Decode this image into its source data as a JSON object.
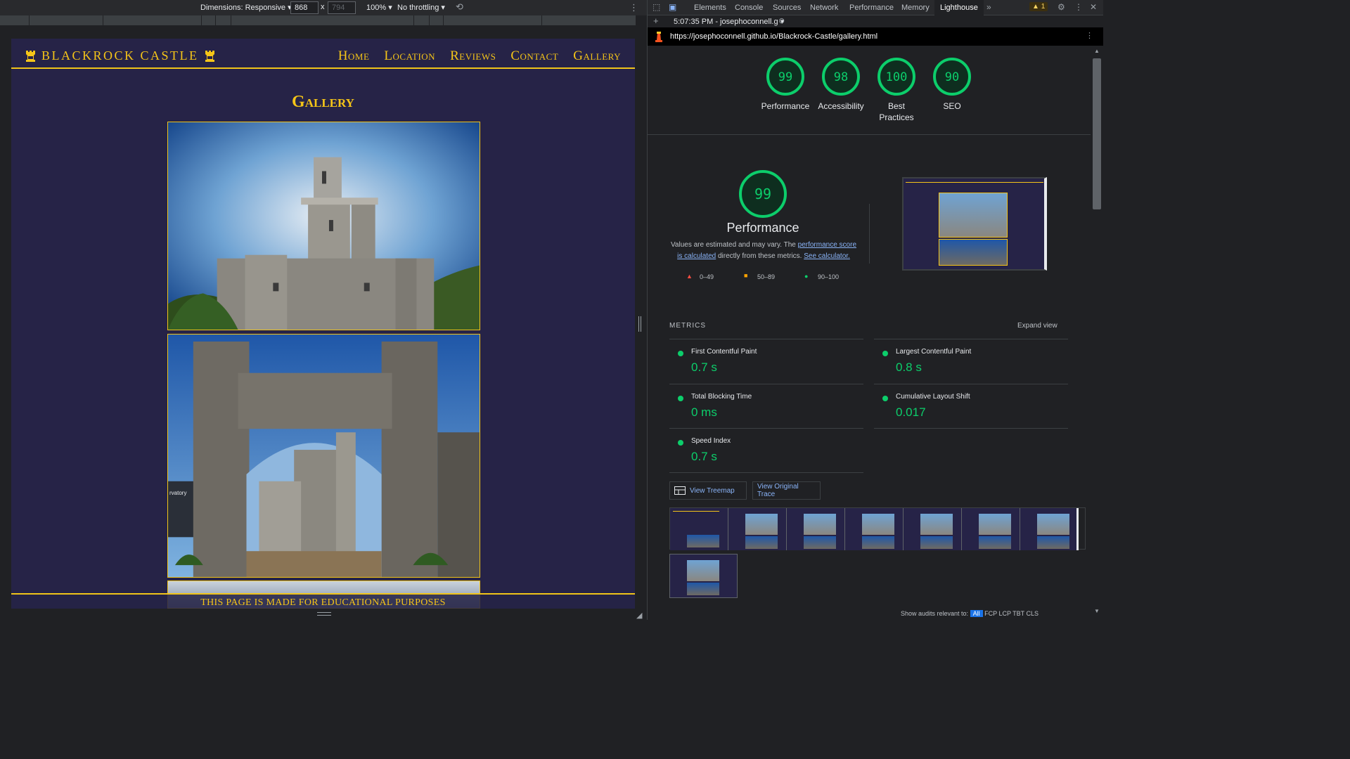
{
  "device_toolbar": {
    "dimensions_label": "Dimensions: Responsive",
    "width_value": "868",
    "height_placeholder": "794",
    "times": "x",
    "zoom": "100%",
    "throttling": "No throttling"
  },
  "site": {
    "logo_text": "Blackrock Castle",
    "nav": [
      "Home",
      "Location",
      "Reviews",
      "Contact",
      "Gallery"
    ],
    "page_title": "Gallery",
    "photo_sign_text": "rvatory",
    "footer_text": "THIS PAGE IS MADE FOR EDUCATIONAL PURPOSES"
  },
  "devtools": {
    "tabs": [
      "Elements",
      "Console",
      "Sources",
      "Network",
      "Performance",
      "Memory",
      "Lighthouse"
    ],
    "active_tab": "Lighthouse",
    "more_tabs": "»",
    "warning_count": "1",
    "report_selector": "5:07:35 PM - josephoconnell.g",
    "url": "https://josephoconnell.github.io/Blackrock-Castle/gallery.html"
  },
  "lighthouse": {
    "categories": [
      {
        "label": "Performance",
        "score": 99
      },
      {
        "label": "Accessibility",
        "score": 98
      },
      {
        "label": "Best Practices",
        "score": 100
      },
      {
        "label": "SEO",
        "score": 90
      }
    ],
    "perf_score": "99",
    "perf_title": "Performance",
    "desc_prefix": "Values are estimated and may vary. The",
    "desc_link1": "performance score is calculated",
    "desc_mid": "directly from these metrics.",
    "desc_link2": "See calculator.",
    "legend": [
      "0–49",
      "50–89",
      "90–100"
    ],
    "metrics_header": "METRICS",
    "expand_view": "Expand view",
    "metrics": [
      {
        "name": "First Contentful Paint",
        "value": "0.7 s"
      },
      {
        "name": "Largest Contentful Paint",
        "value": "0.8 s"
      },
      {
        "name": "Total Blocking Time",
        "value": "0 ms"
      },
      {
        "name": "Cumulative Layout Shift",
        "value": "0.017"
      },
      {
        "name": "Speed Index",
        "value": "0.7 s"
      }
    ],
    "view_treemap": "View Treemap",
    "view_trace": "View Original Trace",
    "audits_relevant": "Show audits relevant to:",
    "audit_filters": [
      "All",
      "FCP",
      "LCP",
      "TBT",
      "CLS"
    ]
  },
  "colors": {
    "site_bg": "#262347",
    "accent_gold": "#f5c518",
    "pass_green": "#0cce6b",
    "devtools_bg": "#202124"
  }
}
